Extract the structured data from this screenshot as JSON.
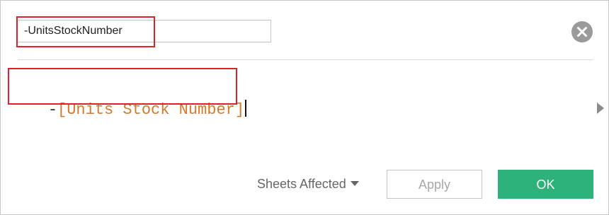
{
  "dialog": {
    "name_field": {
      "value": "-UnitsStockNumber"
    },
    "formula": {
      "operator": "-",
      "field": "[Units Stock Number]"
    },
    "footer": {
      "sheets_affected_label": "Sheets Affected",
      "apply_label": "Apply",
      "ok_label": "OK"
    },
    "icons": {
      "close": "close-icon",
      "expand": "expand-arrow-icon",
      "dropdown": "chevron-down-icon"
    },
    "colors": {
      "ok_button": "#2db37a",
      "field_reference": "#d6792c",
      "highlight": "#e0202a"
    }
  }
}
